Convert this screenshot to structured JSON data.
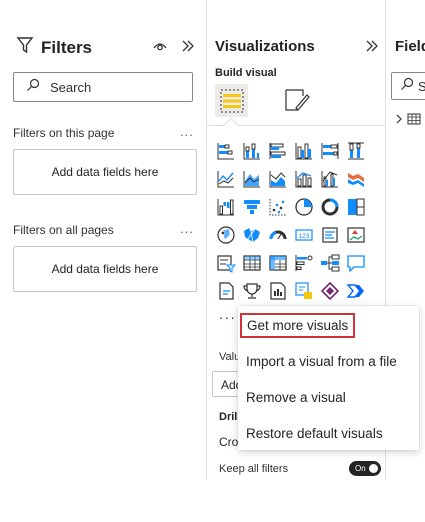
{
  "filters": {
    "title": "Filters",
    "search_placeholder": "Search",
    "sections": [
      {
        "label": "Filters on this page",
        "more": "...",
        "drop_text": "Add data fields here"
      },
      {
        "label": "Filters on all pages",
        "more": "...",
        "drop_text": "Add data fields here"
      }
    ]
  },
  "visualizations": {
    "title": "Visualizations",
    "subtitle": "Build visual",
    "more_dots": "...",
    "values_label": "Valu",
    "add_box": "Add",
    "drill_label": "Dril",
    "cross_label": "Cro",
    "keep_filters_label": "Keep all filters",
    "toggle_text": "On",
    "icons": [
      "stacked-bar-chart-icon",
      "stacked-column-chart-icon",
      "clustered-bar-chart-icon",
      "clustered-column-chart-icon",
      "100-stacked-bar-chart-icon",
      "100-stacked-column-chart-icon",
      "line-chart-icon",
      "area-chart-icon",
      "stacked-area-chart-icon",
      "line-and-stacked-column-icon",
      "line-and-clustered-column-icon",
      "ribbon-chart-icon",
      "waterfall-chart-icon",
      "funnel-chart-icon",
      "scatter-chart-icon",
      "pie-chart-icon",
      "donut-chart-icon",
      "treemap-icon",
      "map-icon",
      "filled-map-icon",
      "gauge-icon",
      "card-icon",
      "multi-row-card-icon",
      "kpi-icon",
      "slicer-icon",
      "table-icon",
      "matrix-icon",
      "key-influencers-icon",
      "decomposition-tree-icon",
      "qa-icon",
      "paginated-report-icon",
      "goals-icon",
      "r-script-visual-icon",
      "python-visual-icon",
      "power-apps-icon",
      "power-automate-icon"
    ]
  },
  "fields": {
    "title": "Fields",
    "search_placeholder": "S"
  },
  "context_menu": {
    "items": [
      "Get more visuals",
      "Import a visual from a file",
      "Remove a visual",
      "Restore default visuals"
    ]
  },
  "colors": {
    "accent_blue": "#0078d4",
    "highlight_red": "#d13438",
    "build_tab_yellow": "#f2c811"
  }
}
